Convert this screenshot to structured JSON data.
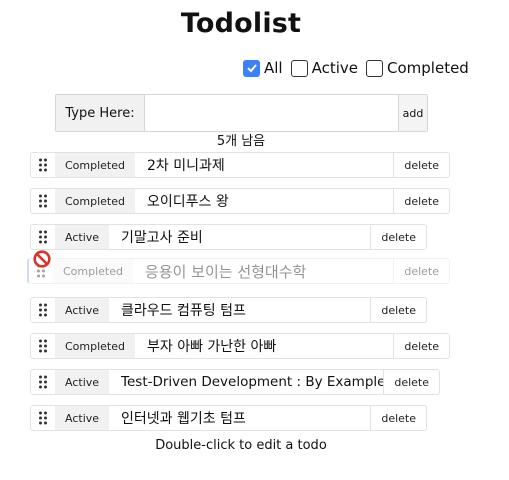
{
  "app": {
    "title": "Todolist"
  },
  "filters": [
    {
      "label": "All",
      "checked": true
    },
    {
      "label": "Active",
      "checked": false
    },
    {
      "label": "Completed",
      "checked": false
    }
  ],
  "input": {
    "label": "Type Here:",
    "value": "",
    "add_label": "add"
  },
  "remaining": "5개 남음",
  "todos": [
    {
      "status": "Completed",
      "text": "2차 미니과제",
      "delete": "delete"
    },
    {
      "status": "Completed",
      "text": "오이디푸스 왕",
      "delete": "delete"
    },
    {
      "status": "Active",
      "text": "기말고사 준비",
      "delete": "delete"
    },
    {
      "status": "Completed",
      "text": "응용이 보이는 선형대수학",
      "delete": "delete",
      "dragging": true
    },
    {
      "status": "Active",
      "text": "클라우드 컴퓨팅 텀프",
      "delete": "delete"
    },
    {
      "status": "Completed",
      "text": "부자 아빠 가난한 아빠",
      "delete": "delete"
    },
    {
      "status": "Active",
      "text": "Test-Driven Development : By Example",
      "delete": "delete"
    },
    {
      "status": "Active",
      "text": "인터넷과 웹기초 텀프",
      "delete": "delete"
    }
  ],
  "footer": "Double-click to edit a todo",
  "icons": {
    "checkmark": "check-icon",
    "drag": "drag-handle-icon",
    "no_drop": "no-drop-icon"
  },
  "colors": {
    "accent": "#3b82f6",
    "no_drop": "#d9342b"
  }
}
